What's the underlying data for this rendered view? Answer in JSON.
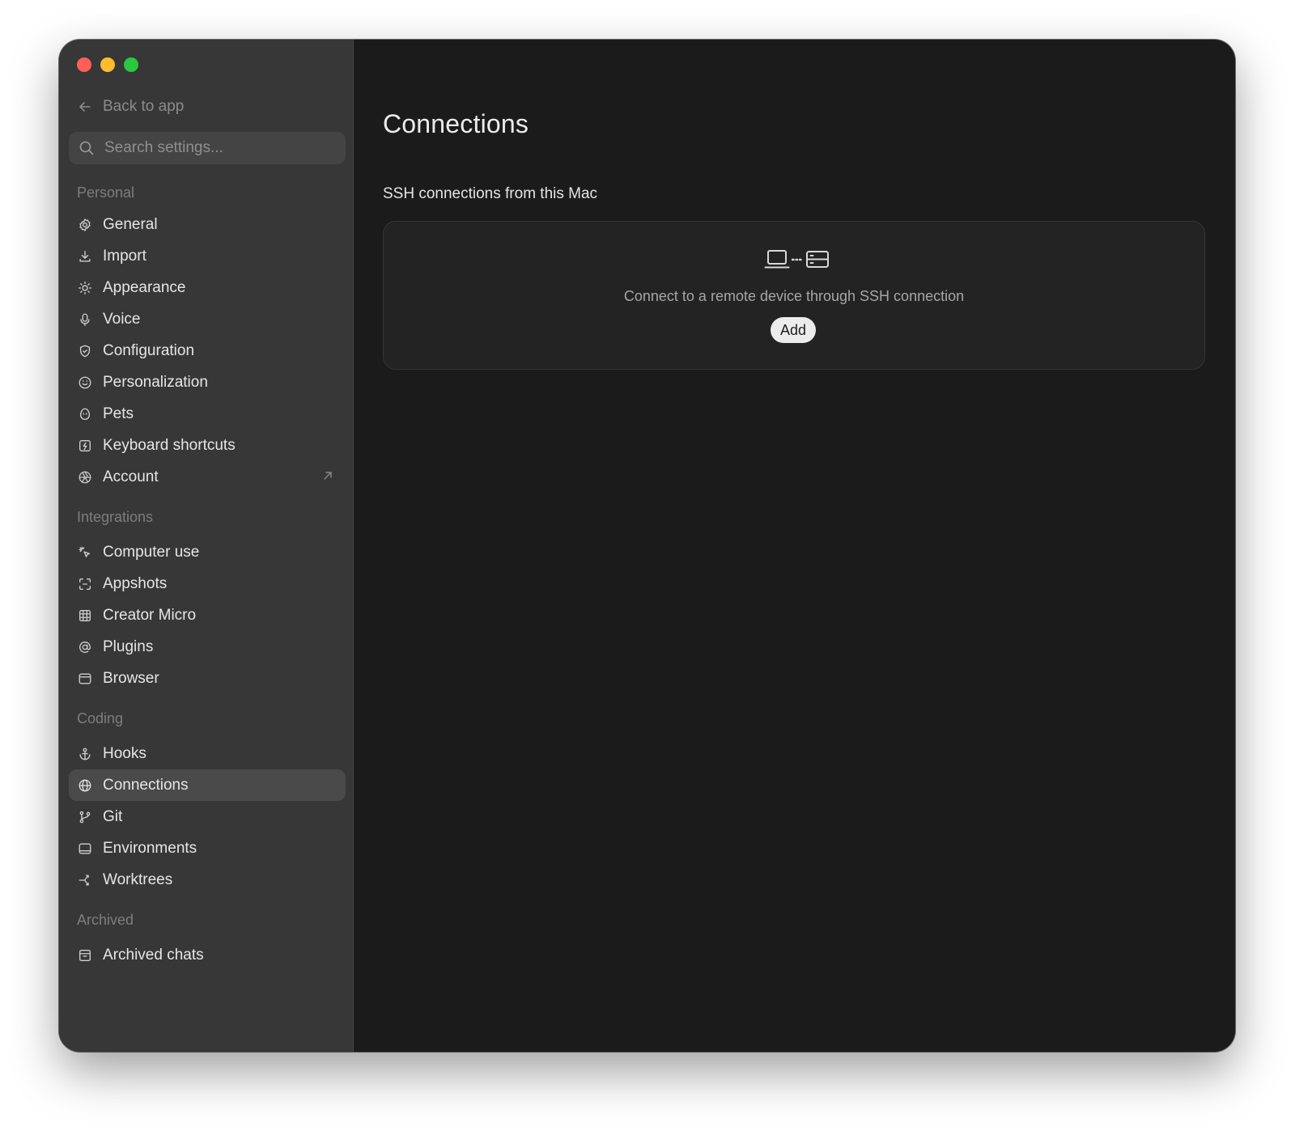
{
  "sidebar": {
    "back_label": "Back to app",
    "search_placeholder": "Search settings...",
    "sections": [
      {
        "title": "Personal",
        "items": [
          {
            "label": "General",
            "icon": "gear-icon"
          },
          {
            "label": "Import",
            "icon": "download-icon"
          },
          {
            "label": "Appearance",
            "icon": "sun-icon"
          },
          {
            "label": "Voice",
            "icon": "microphone-icon"
          },
          {
            "label": "Configuration",
            "icon": "shield-icon"
          },
          {
            "label": "Personalization",
            "icon": "smile-icon"
          },
          {
            "label": "Pets",
            "icon": "egg-icon"
          },
          {
            "label": "Keyboard shortcuts",
            "icon": "keyboard-icon"
          },
          {
            "label": "Account",
            "icon": "aperture-icon"
          }
        ]
      },
      {
        "title": "Integrations",
        "items": [
          {
            "label": "Computer use",
            "icon": "sparkle-cursor-icon"
          },
          {
            "label": "Appshots",
            "icon": "screenshot-frame-icon"
          },
          {
            "label": "Creator Micro",
            "icon": "grid-icon"
          },
          {
            "label": "Plugins",
            "icon": "at-sign-icon"
          },
          {
            "label": "Browser",
            "icon": "browser-window-icon"
          }
        ]
      },
      {
        "title": "Coding",
        "items": [
          {
            "label": "Hooks",
            "icon": "anchor-icon"
          },
          {
            "label": "Connections",
            "icon": "globe-icon"
          },
          {
            "label": "Git",
            "icon": "git-branch-icon"
          },
          {
            "label": "Environments",
            "icon": "monitor-icon"
          },
          {
            "label": "Worktrees",
            "icon": "worktree-icon"
          }
        ]
      },
      {
        "title": "Archived",
        "items": [
          {
            "label": "Archived chats",
            "icon": "archive-box-icon"
          }
        ]
      }
    ],
    "active_item": "Connections"
  },
  "main": {
    "title": "Connections",
    "section_title": "SSH connections from this Mac",
    "empty_state": {
      "icon": "laptop-to-server-icon",
      "text": "Connect to a remote device through SSH connection",
      "button_label": "Add"
    }
  },
  "colors": {
    "sidebar_bg": "#373737",
    "main_bg": "#1b1b1b",
    "card_bg": "#232323",
    "active_item_bg": "#4a4a4a",
    "traffic_red": "#fe5f57",
    "traffic_yellow": "#febc2e",
    "traffic_green": "#28c840"
  }
}
